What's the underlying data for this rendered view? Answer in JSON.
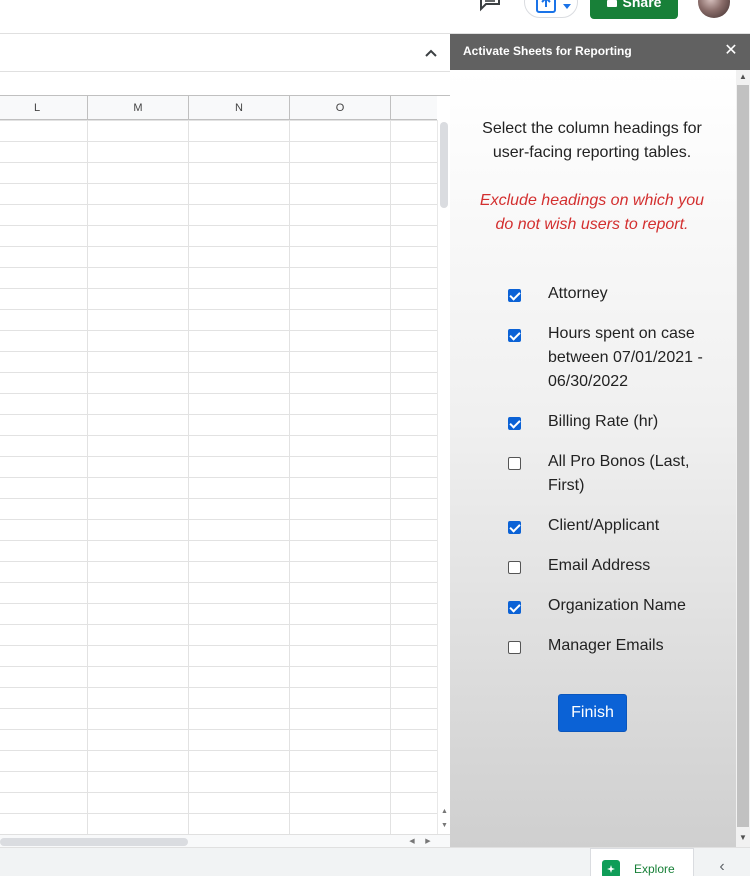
{
  "toolbar": {
    "share_label": "Share"
  },
  "grid": {
    "columns": [
      "L",
      "M",
      "N",
      "O"
    ]
  },
  "panel": {
    "title": "Activate Sheets for Reporting",
    "intro": "Select the column headings for user-facing reporting tables.",
    "warning": "Exclude headings on which you do not wish users to report.",
    "options": [
      {
        "label": "Attorney",
        "checked": true
      },
      {
        "label": "Hours spent on case between 07/01/2021 - 06/30/2022",
        "checked": true
      },
      {
        "label": "Billing Rate (hr)",
        "checked": true
      },
      {
        "label": "All Pro Bonos (Last, First)",
        "checked": false
      },
      {
        "label": "Client/Applicant",
        "checked": true
      },
      {
        "label": "Email Address",
        "checked": false
      },
      {
        "label": "Organization Name",
        "checked": true
      },
      {
        "label": "Manager Emails",
        "checked": false
      }
    ],
    "finish_label": "Finish"
  },
  "bottom": {
    "explore_label": "Explore"
  },
  "colors": {
    "accent": "#0b62d6",
    "share_green": "#188038",
    "warning_red": "#d32f2f",
    "panel_header": "#616161"
  },
  "icons": [
    "comment-icon",
    "new-icon",
    "lock-icon",
    "avatar",
    "chevron-up-icon",
    "close-icon",
    "explore-icon",
    "chevron-left-icon"
  ]
}
